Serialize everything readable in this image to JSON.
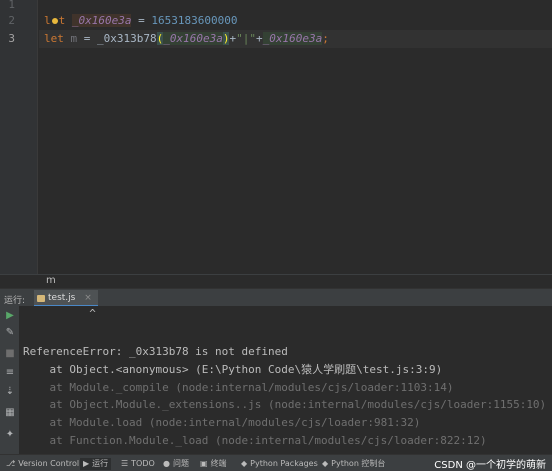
{
  "editor": {
    "line_numbers": [
      "1",
      "2",
      "3"
    ],
    "line2": {
      "kw": "let",
      "var": "_0x160e3a",
      "op": " = ",
      "num": "1653183600000"
    },
    "line3": {
      "kw": "let",
      "var": "m",
      "op1": " = ",
      "fn": "_0x313b78",
      "open": "(",
      "arg": "_0x160e3a",
      "close": ")",
      "plus1": "+",
      "str": "\"|\"",
      "plus2": "+",
      "var2": "_0x160e3a",
      "semi": ";"
    },
    "breadcrumb": "m"
  },
  "run_panel": {
    "title": "运行:",
    "tab_label": "test.js",
    "tab_close": "×",
    "console_lines": [
      {
        "text": "          ^",
        "style": "c-err"
      },
      {
        "text": "",
        "style": "c-err"
      },
      {
        "text": "ReferenceError: _0x313b78 is not defined",
        "style": "c-err"
      },
      {
        "text": "    at Object.<anonymous> (E:\\Python Code\\猿人学刷题\\test.js:3:9)",
        "style": "c-err"
      },
      {
        "text": "    at Module._compile (node:internal/modules/cjs/loader:1103:14)",
        "style": "c-grey"
      },
      {
        "text": "    at Object.Module._extensions..js (node:internal/modules/cjs/loader:1155:10)",
        "style": "c-grey"
      },
      {
        "text": "    at Module.load (node:internal/modules/cjs/loader:981:32)",
        "style": "c-grey"
      },
      {
        "text": "    at Function.Module._load (node:internal/modules/cjs/loader:822:12)",
        "style": "c-grey"
      }
    ]
  },
  "status_bar": {
    "items": [
      {
        "icon": "⎇",
        "label": "Version Control",
        "name": "status-version-control"
      },
      {
        "icon": "▶",
        "label": "运行",
        "name": "status-run"
      },
      {
        "icon": "☰",
        "label": "TODO",
        "name": "status-todo"
      },
      {
        "icon": "●",
        "label": "问题",
        "name": "status-problems"
      },
      {
        "icon": "▣",
        "label": "终端",
        "name": "status-terminal"
      },
      {
        "icon": "◆",
        "label": "Python Packages",
        "name": "status-python-packages"
      },
      {
        "icon": "◆",
        "label": "Python 控制台",
        "name": "status-python-console"
      }
    ],
    "watermark": "CSDN @一个初学的萌新"
  }
}
